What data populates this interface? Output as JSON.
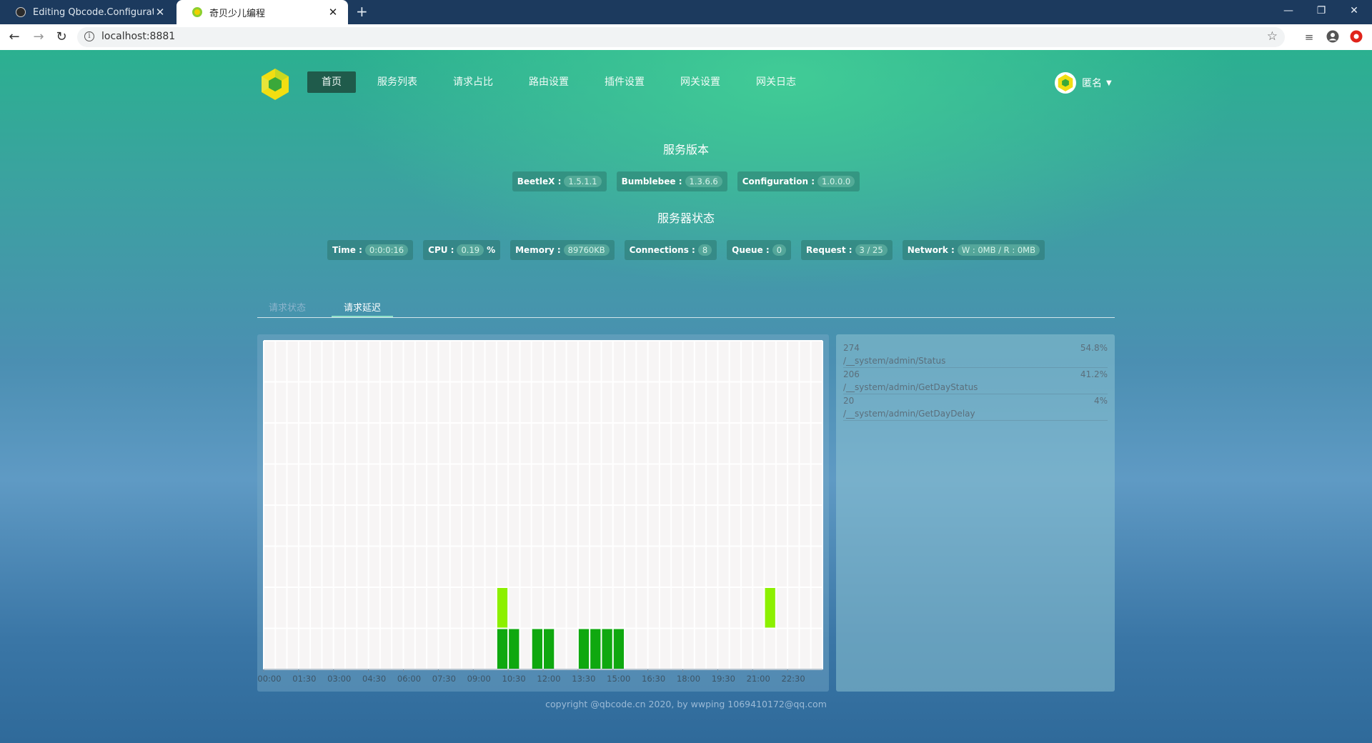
{
  "browser": {
    "tabs": [
      {
        "title": "Editing Qbcode.Configuration",
        "active": false,
        "icon": "github-icon"
      },
      {
        "title": "奇贝少儿编程",
        "active": true,
        "icon": "site-favicon"
      }
    ],
    "url": "localhost:8881"
  },
  "nav": {
    "items": [
      "首页",
      "服务列表",
      "请求占比",
      "路由设置",
      "插件设置",
      "网关设置",
      "网关日志"
    ],
    "active_index": 0,
    "user": "匿名"
  },
  "versions": {
    "title": "服务版本",
    "items": [
      {
        "label": "BeetleX :",
        "value": "1.5.1.1"
      },
      {
        "label": "Bumblebee :",
        "value": "1.3.6.6"
      },
      {
        "label": "Configuration :",
        "value": "1.0.0.0"
      }
    ]
  },
  "server_status": {
    "title": "服务器状态",
    "items": [
      {
        "label": "Time :",
        "value": "0:0:0:16",
        "suffix": ""
      },
      {
        "label": "CPU :",
        "value": "0.19",
        "suffix": "%"
      },
      {
        "label": "Memory :",
        "value": "89760KB",
        "suffix": ""
      },
      {
        "label": "Connections :",
        "value": "8",
        "suffix": ""
      },
      {
        "label": "Queue :",
        "value": "0",
        "suffix": ""
      },
      {
        "label": "Request :",
        "value": "3 / 25",
        "suffix": ""
      },
      {
        "label": "Network :",
        "value": "W : 0MB / R : 0MB",
        "suffix": ""
      }
    ]
  },
  "tabs": [
    {
      "label": "请求状态",
      "active": false
    },
    {
      "label": "请求延迟",
      "active": true
    }
  ],
  "chart_data": {
    "type": "heatmap",
    "x_labels": [
      "00:00",
      "01:30",
      "03:00",
      "04:30",
      "06:00",
      "07:30",
      "09:00",
      "10:30",
      "12:00",
      "13:30",
      "15:00",
      "16:30",
      "18:00",
      "19:30",
      "21:00",
      "22:30"
    ],
    "columns": 48,
    "rows": 8,
    "grid": true,
    "cells": [
      {
        "col": 20,
        "row": 1,
        "color": "#8cf000"
      },
      {
        "col": 43,
        "row": 1,
        "color": "#8cf000"
      },
      {
        "col": 20,
        "row": 0,
        "color": "#0fa80f"
      },
      {
        "col": 21,
        "row": 0,
        "color": "#0fa80f"
      },
      {
        "col": 23,
        "row": 0,
        "color": "#0fa80f"
      },
      {
        "col": 24,
        "row": 0,
        "color": "#0fa80f"
      },
      {
        "col": 27,
        "row": 0,
        "color": "#0fa80f"
      },
      {
        "col": 28,
        "row": 0,
        "color": "#0fa80f"
      },
      {
        "col": 29,
        "row": 0,
        "color": "#0fa80f"
      },
      {
        "col": 30,
        "row": 0,
        "color": "#0fa80f"
      }
    ]
  },
  "requests": [
    {
      "count": "274",
      "percent": "54.8%",
      "path": "/__system/admin/Status"
    },
    {
      "count": "206",
      "percent": "41.2%",
      "path": "/__system/admin/GetDayStatus"
    },
    {
      "count": "20",
      "percent": "4%",
      "path": "/__system/admin/GetDayDelay"
    }
  ],
  "footer": "copyright @qbcode.cn 2020, by wwping 1069410172@qq.com",
  "colors": {
    "accent": "#1f5b4b",
    "bar_light": "#8cf000",
    "bar_dark": "#0fa80f"
  }
}
